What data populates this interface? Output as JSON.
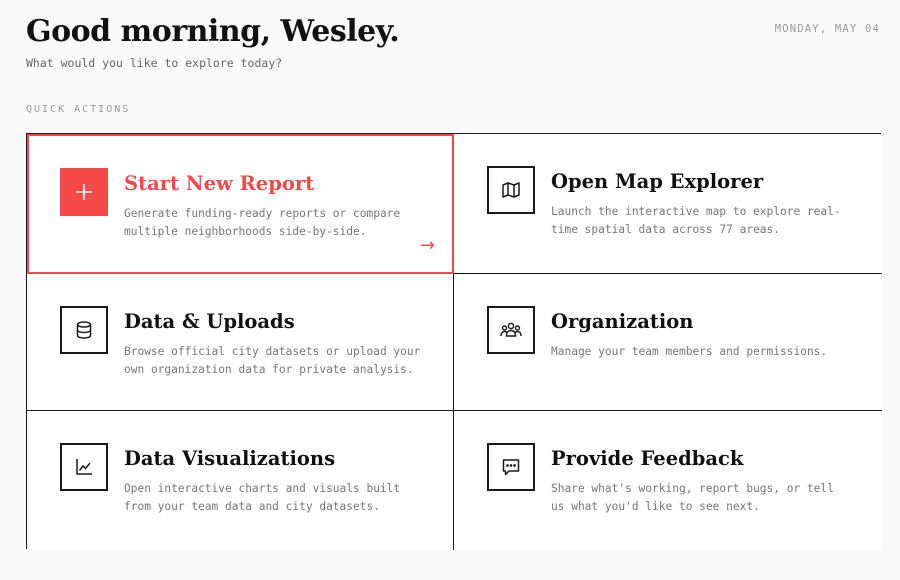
{
  "header": {
    "greeting": "Good morning, Wesley.",
    "subtitle": "What would you like to explore today?",
    "date": "MONDAY, MAY 04"
  },
  "quick_actions": {
    "label": "QUICK ACTIONS",
    "cards": [
      {
        "title": "Start New Report",
        "description": "Generate funding-ready reports or compare multiple neighborhoods side-by-side.",
        "icon": "plus-icon",
        "arrow": "→"
      },
      {
        "title": "Open Map Explorer",
        "description": "Launch the interactive map to explore real-time spatial data across 77 areas.",
        "icon": "map-icon"
      },
      {
        "title": "Data & Uploads",
        "description": "Browse official city datasets or upload your own organization data for private analysis.",
        "icon": "database-icon"
      },
      {
        "title": "Organization",
        "description": "Manage your team members and permissions.",
        "icon": "team-icon"
      },
      {
        "title": "Data Visualizations",
        "description": "Open interactive charts and visuals built from your team data and city datasets.",
        "icon": "chart-icon"
      },
      {
        "title": "Provide Feedback",
        "description": "Share what's working, report bugs, or tell us what you'd like to see next.",
        "icon": "message-icon"
      }
    ]
  },
  "colors": {
    "accent": "#f44a4a",
    "text": "#111111",
    "muted": "#777777",
    "background": "#fafafa"
  }
}
